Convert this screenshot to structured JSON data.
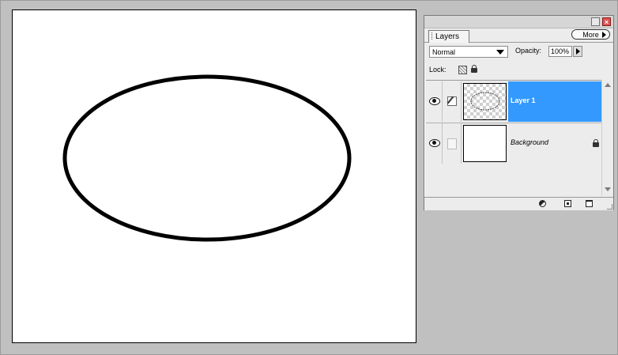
{
  "panel": {
    "tab_label": "Layers",
    "more_label": "More",
    "blend_mode": "Normal",
    "opacity_label": "Opacity:",
    "opacity_value": "100%",
    "lock_label": "Lock:",
    "window_close_glyph": "×",
    "selection_color": "#3399ff"
  },
  "layers": [
    {
      "name": "Layer 1",
      "selected": true,
      "visible": true,
      "locked": false
    },
    {
      "name": "Background",
      "selected": false,
      "visible": true,
      "locked": true
    }
  ],
  "icons": {
    "eye": "eye-icon",
    "brush": "brush-icon",
    "lock": "lock-icon",
    "layer_style": "layer-style-icon",
    "new_layer": "new-layer-icon",
    "trash": "trash-icon"
  }
}
